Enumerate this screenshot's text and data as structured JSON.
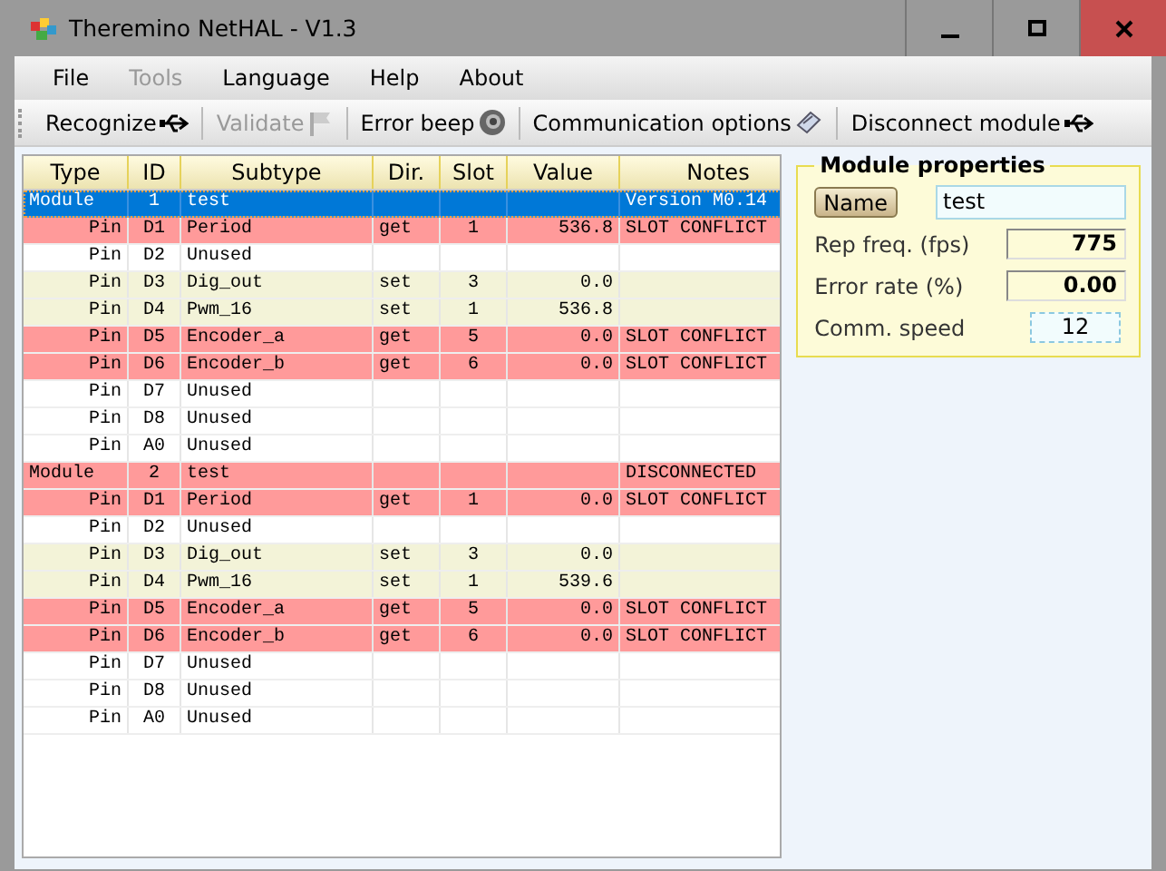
{
  "window": {
    "title": "Theremino NetHAL - V1.3"
  },
  "menu": [
    {
      "label": "File",
      "disabled": false
    },
    {
      "label": "Tools",
      "disabled": true
    },
    {
      "label": "Language",
      "disabled": false
    },
    {
      "label": "Help",
      "disabled": false
    },
    {
      "label": "About",
      "disabled": false
    }
  ],
  "toolbar": [
    {
      "label": "Recognize",
      "disabled": false
    },
    {
      "label": "Validate",
      "disabled": true
    },
    {
      "label": "Error beep",
      "disabled": false
    },
    {
      "label": "Communication options",
      "disabled": false
    },
    {
      "label": "Disconnect module",
      "disabled": false
    }
  ],
  "table": {
    "columns": [
      "Type",
      "ID",
      "Subtype",
      "Dir.",
      "Slot",
      "Value",
      "Notes"
    ],
    "rows": [
      {
        "cells": [
          "Module",
          "1",
          "test",
          "",
          "",
          "",
          "Version M0.14"
        ],
        "color": "#0078d7",
        "selected": true
      },
      {
        "cells": [
          "Pin",
          "D1",
          "Period",
          "get",
          "1",
          "536.8",
          "SLOT CONFLICT"
        ],
        "color": "#ff9a9a",
        "selected": false
      },
      {
        "cells": [
          "Pin",
          "D2",
          "Unused",
          "",
          "",
          "",
          ""
        ],
        "color": "#ffffff",
        "selected": false
      },
      {
        "cells": [
          "Pin",
          "D3",
          "Dig_out",
          "set",
          "3",
          "0.0",
          ""
        ],
        "color": "#f3f3d8",
        "selected": false
      },
      {
        "cells": [
          "Pin",
          "D4",
          "Pwm_16",
          "set",
          "1",
          "536.8",
          ""
        ],
        "color": "#f3f3d8",
        "selected": false
      },
      {
        "cells": [
          "Pin",
          "D5",
          "Encoder_a",
          "get",
          "5",
          "0.0",
          "SLOT CONFLICT"
        ],
        "color": "#ff9a9a",
        "selected": false
      },
      {
        "cells": [
          "Pin",
          "D6",
          "Encoder_b",
          "get",
          "6",
          "0.0",
          "SLOT CONFLICT"
        ],
        "color": "#ff9a9a",
        "selected": false
      },
      {
        "cells": [
          "Pin",
          "D7",
          "Unused",
          "",
          "",
          "",
          ""
        ],
        "color": "#ffffff",
        "selected": false
      },
      {
        "cells": [
          "Pin",
          "D8",
          "Unused",
          "",
          "",
          "",
          ""
        ],
        "color": "#ffffff",
        "selected": false
      },
      {
        "cells": [
          "Pin",
          "A0",
          "Unused",
          "",
          "",
          "",
          ""
        ],
        "color": "#ffffff",
        "selected": false
      },
      {
        "cells": [
          "Module",
          "2",
          "test",
          "",
          "",
          "",
          "DISCONNECTED"
        ],
        "color": "#ff9a9a",
        "selected": false
      },
      {
        "cells": [
          "Pin",
          "D1",
          "Period",
          "get",
          "1",
          "0.0",
          "SLOT CONFLICT"
        ],
        "color": "#ff9a9a",
        "selected": false
      },
      {
        "cells": [
          "Pin",
          "D2",
          "Unused",
          "",
          "",
          "",
          ""
        ],
        "color": "#ffffff",
        "selected": false
      },
      {
        "cells": [
          "Pin",
          "D3",
          "Dig_out",
          "set",
          "3",
          "0.0",
          ""
        ],
        "color": "#f3f3d8",
        "selected": false
      },
      {
        "cells": [
          "Pin",
          "D4",
          "Pwm_16",
          "set",
          "1",
          "539.6",
          ""
        ],
        "color": "#f3f3d8",
        "selected": false
      },
      {
        "cells": [
          "Pin",
          "D5",
          "Encoder_a",
          "get",
          "5",
          "0.0",
          "SLOT CONFLICT"
        ],
        "color": "#ff9a9a",
        "selected": false
      },
      {
        "cells": [
          "Pin",
          "D6",
          "Encoder_b",
          "get",
          "6",
          "0.0",
          "SLOT CONFLICT"
        ],
        "color": "#ff9a9a",
        "selected": false
      },
      {
        "cells": [
          "Pin",
          "D7",
          "Unused",
          "",
          "",
          "",
          ""
        ],
        "color": "#ffffff",
        "selected": false
      },
      {
        "cells": [
          "Pin",
          "D8",
          "Unused",
          "",
          "",
          "",
          ""
        ],
        "color": "#ffffff",
        "selected": false
      },
      {
        "cells": [
          "Pin",
          "A0",
          "Unused",
          "",
          "",
          "",
          ""
        ],
        "color": "#ffffff",
        "selected": false
      }
    ]
  },
  "module_properties": {
    "title": "Module properties",
    "name_button": "Name",
    "name_value": "test",
    "fields": [
      {
        "label": "Rep freq. (fps)",
        "value": "775"
      },
      {
        "label": "Error rate (%)",
        "value": "0.00"
      },
      {
        "label": "Comm. speed",
        "value": "12"
      }
    ]
  }
}
